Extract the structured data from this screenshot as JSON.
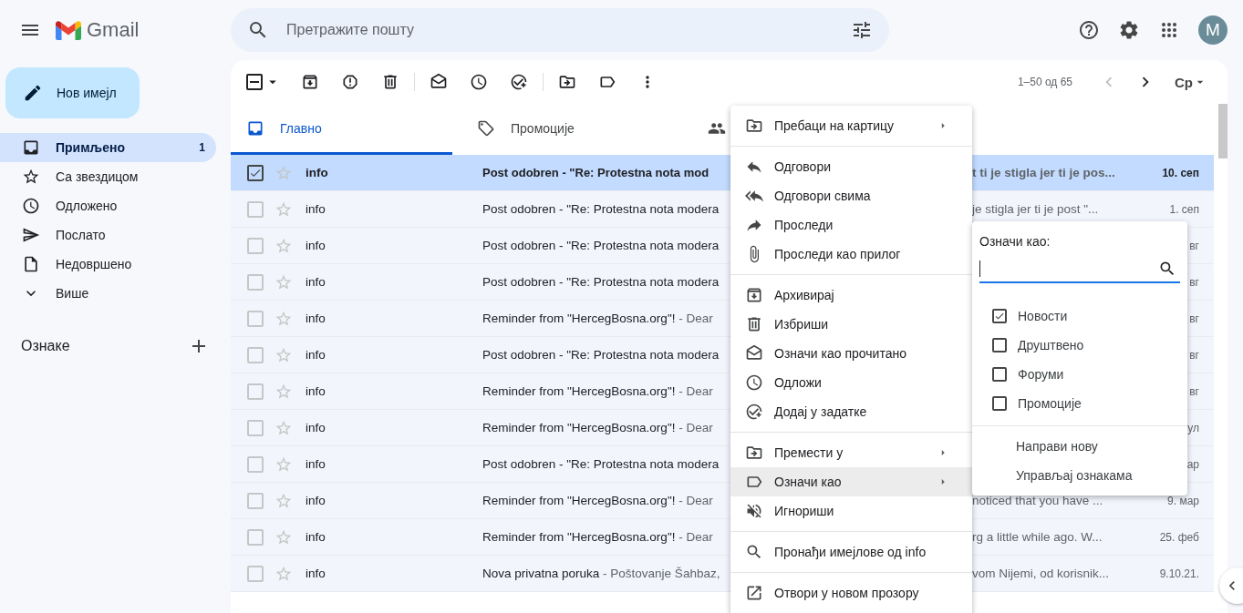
{
  "header": {
    "logo": "Gmail",
    "search": {
      "placeholder": "Претражите пошту"
    },
    "avatar": "M"
  },
  "compose": "Нов имејл",
  "sidebar": {
    "items": [
      {
        "label": "Примљено",
        "count": "1",
        "selected": true
      },
      {
        "label": "Са звездицом",
        "selected": false
      },
      {
        "label": "Одложено",
        "selected": false
      },
      {
        "label": "Послато",
        "selected": false
      },
      {
        "label": "Недовршено",
        "selected": false
      },
      {
        "label": "Више",
        "selected": false
      }
    ],
    "labels_heading": "Ознаке"
  },
  "toolbar": {
    "select_all_partial": true,
    "pagination": "1–50 од 65",
    "previous_disabled": true,
    "input_tool": "Ср"
  },
  "tabs": [
    {
      "label": "Главно",
      "selected": true
    },
    {
      "label": "Промоције",
      "selected": false
    },
    {
      "selected": false
    }
  ],
  "emails": [
    {
      "sender": "info",
      "subject": "Post odobren - \"Re: Protestna nota mod",
      "snippet_end": "t ti je stigla jer ti je pos...",
      "date": "10. сеп",
      "unread": true,
      "selected": true,
      "starred": false
    },
    {
      "sender": "info",
      "subject": "Post odobren - \"Re: Protestna nota modera",
      "snippet_end": "je stigla jer ti je post \"...",
      "date": "1. сеп",
      "unread": false,
      "selected": false,
      "starred": false
    },
    {
      "sender": "info",
      "subject": "Post odobren - \"Re: Protestna nota modera",
      "date": "вг",
      "unread": false,
      "selected": false,
      "starred": false
    },
    {
      "sender": "info",
      "subject": "Post odobren - \"Re: Protestna nota modera",
      "date": "вг",
      "unread": false,
      "selected": false,
      "starred": false
    },
    {
      "sender": "info",
      "subject": "Reminder from \"HercegBosna.org\"!",
      "snippet": " - Dear",
      "date": "вг",
      "unread": false,
      "selected": false,
      "starred": false
    },
    {
      "sender": "info",
      "subject": "Post odobren - \"Re: Protestna nota modera",
      "date": "вг",
      "unread": false,
      "selected": false,
      "starred": false
    },
    {
      "sender": "info",
      "subject": "Reminder from \"HercegBosna.org\"!",
      "snippet": " - Dear",
      "date": "вг",
      "unread": false,
      "selected": false,
      "starred": false
    },
    {
      "sender": "info",
      "subject": "Reminder from \"HercegBosna.org\"!",
      "snippet": " - Dear",
      "date": "ул",
      "unread": false,
      "selected": false,
      "starred": false
    },
    {
      "sender": "info",
      "subject": "Post odobren - \"Re: Protestna nota modera",
      "date": "ар",
      "unread": false,
      "selected": false,
      "starred": false
    },
    {
      "sender": "info",
      "subject": "Reminder from \"HercegBosna.org\"!",
      "snippet": " - Dear",
      "snippet_end": "noticed that you have ...",
      "date": "9. мар",
      "unread": false,
      "selected": false,
      "starred": false
    },
    {
      "sender": "info",
      "subject": "Reminder from \"HercegBosna.org\"!",
      "snippet": " - Dear",
      "snippet_end": "rg a little while ago. W...",
      "date": "25. феб",
      "unread": false,
      "selected": false,
      "starred": false
    },
    {
      "sender": "info",
      "subject": "Nova privatna poruka",
      "snippet": " - Poštovanje Šahbaz,",
      "snippet_end": "vom Nijemi, od korisnik...",
      "date": "9.10.21.",
      "unread": false,
      "selected": false,
      "starred": false
    }
  ],
  "context_menu": {
    "groups": [
      [
        {
          "label": "Пребаци на картицу",
          "submenu": true,
          "highlighted": false
        }
      ],
      [
        {
          "label": "Одговори",
          "submenu": false,
          "highlighted": false
        },
        {
          "label": "Одговори свима",
          "submenu": false,
          "highlighted": false
        },
        {
          "label": "Проследи",
          "submenu": false,
          "highlighted": false
        },
        {
          "label": "Проследи као прилог",
          "submenu": false,
          "highlighted": false
        }
      ],
      [
        {
          "label": "Архивирај",
          "submenu": false,
          "highlighted": false
        },
        {
          "label": "Избриши",
          "submenu": false,
          "highlighted": false
        },
        {
          "label": "Означи као прочитано",
          "submenu": false,
          "highlighted": false
        },
        {
          "label": "Одложи",
          "submenu": false,
          "highlighted": false
        },
        {
          "label": "Додај у задатке",
          "submenu": false,
          "highlighted": false
        }
      ],
      [
        {
          "label": "Премести у",
          "submenu": true,
          "highlighted": false
        },
        {
          "label": "Означи као",
          "submenu": true,
          "highlighted": true
        },
        {
          "label": "Игнориши",
          "submenu": false,
          "highlighted": false
        }
      ],
      [
        {
          "label": "Пронађи имејлове од info",
          "submenu": false,
          "highlighted": false
        }
      ],
      [
        {
          "label": "Отвори у новом прозору",
          "submenu": false,
          "highlighted": false
        }
      ]
    ]
  },
  "label_menu": {
    "title": "Означи као:",
    "labels": [
      {
        "label": "Новости",
        "checked": true
      },
      {
        "label": "Друштвено",
        "checked": false
      },
      {
        "label": "Форуми",
        "checked": false
      },
      {
        "label": "Промоције",
        "checked": false
      }
    ],
    "actions": [
      "Направи нову",
      "Управљај ознакама"
    ]
  }
}
